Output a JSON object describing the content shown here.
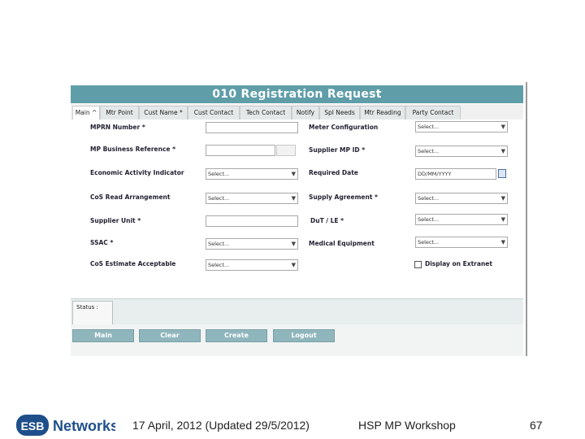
{
  "form": {
    "title": "010 Registration Request",
    "tabs": [
      "Main ^",
      "Mtr Point",
      "Cust Name *",
      "Cust Contact",
      "Tech Contact",
      "Notify",
      "Spl Needs",
      "Mtr Reading",
      "Party Contact"
    ],
    "left_fields": {
      "mprn_label": "MPRN Number *",
      "mp_business_ref_label": "MP Business Reference *",
      "economic_activity_label": "Economic Activity Indicator",
      "economic_activity_value": "Select...",
      "cos_read_label": "CoS Read Arrangement",
      "cos_read_value": "Select...",
      "supplier_unit_label": "Supplier Unit *",
      "ssac_label": "SSAC *",
      "ssac_value": "Select...",
      "cos_estimate_label": "CoS Estimate Acceptable",
      "cos_estimate_value": "Select..."
    },
    "right_fields": {
      "meter_config_label": "Meter Configuration",
      "meter_config_value": "Select...",
      "supplier_mp_id_label": "Supplier MP ID *",
      "supplier_mp_id_value": "Select...",
      "required_date_label": "Required Date",
      "required_date_placeholder": "DD/MM/YYYY",
      "supply_agreement_label": "Supply Agreement *",
      "supply_agreement_value": "Select...",
      "dut_le_label": "DuT / LE *",
      "dut_le_value": "Select...",
      "medical_equipment_label": "Medical Equipment",
      "medical_equipment_value": "Select...",
      "display_extranet_label": "Display on Extranet"
    },
    "status_label": "Status :",
    "buttons": {
      "main": "Main",
      "clear": "Clear",
      "create": "Create",
      "logout": "Logout"
    }
  },
  "footer": {
    "logo_text": "Networks",
    "date": "17 April, 2012 (Updated 29/5/2012)",
    "event": "HSP MP Workshop",
    "page_number": "67"
  },
  "colors": {
    "title_bar": "#5f9ea8",
    "button": "#8fb6bc",
    "logo_blue": "#1f4f8b"
  }
}
